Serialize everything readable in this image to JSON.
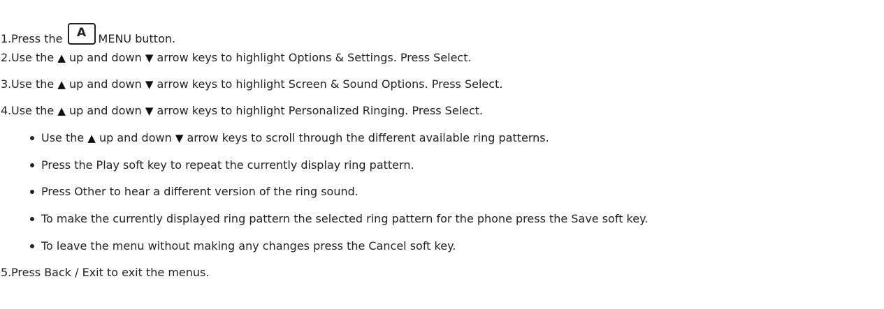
{
  "steps": [
    {
      "num": "1.",
      "before": "Press the",
      "key_icon": "menu-a-key-icon",
      "key_letter": "A",
      "after": "MENU button."
    },
    {
      "num": "2.",
      "t1": "Use the",
      "t2": "up and down",
      "t3": "arrow keys to highlight Options & Settings. Press Select."
    },
    {
      "num": "3.",
      "t1": "Use the",
      "t2": "up and down",
      "t3": "arrow keys to highlight Screen & Sound Options. Press Select."
    },
    {
      "num": "4.",
      "t1": "Use the",
      "t2": "up and down",
      "t3": "arrow keys to highlight Personalized Ringing. Press Select."
    },
    {
      "num": "5.",
      "text": "Press Back / Exit to exit the menus."
    }
  ],
  "substeps": [
    {
      "t1": "Use the",
      "t2": "up and down",
      "t3": "arrow keys to scroll through the different available ring patterns."
    },
    {
      "text": "Press the Play soft key to repeat the currently display ring pattern."
    },
    {
      "text": "Press Other to hear a different version of the ring sound."
    },
    {
      "text": "To make the currently displayed ring pattern the selected ring pattern for the phone press the Save soft key."
    },
    {
      "text": "To leave the menu without making any changes press the Cancel soft key."
    }
  ],
  "icons": {
    "up": "up-arrow-icon",
    "down": "down-arrow-icon",
    "up_glyph": "▲",
    "down_glyph": "▼"
  }
}
